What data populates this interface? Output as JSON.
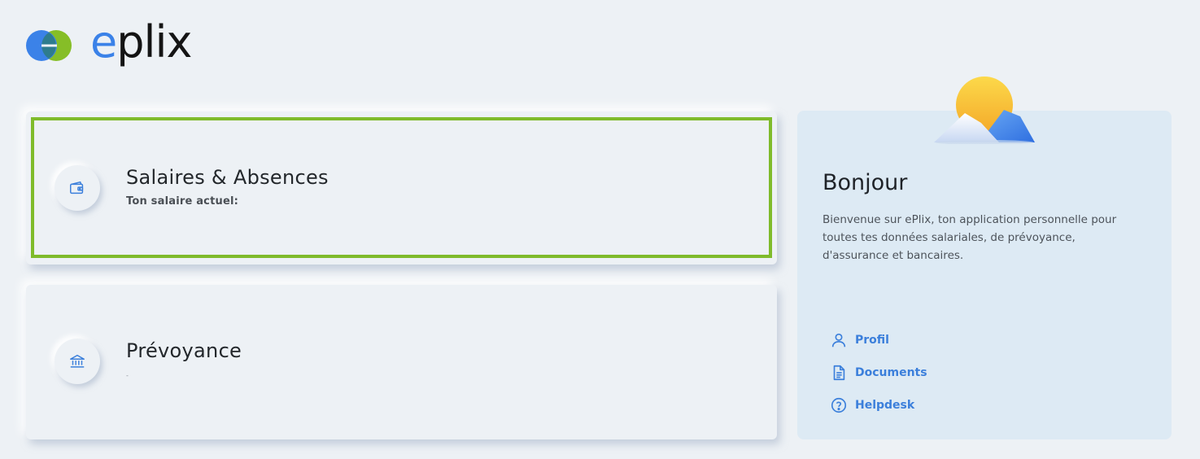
{
  "brand": {
    "name_first": "e",
    "name_rest": "plix",
    "logo_icon": "eplix-logo-icon",
    "colors": {
      "blue": "#3b82e8",
      "green": "#86be27",
      "text": "#141414"
    }
  },
  "cards": {
    "salary": {
      "title": "Salaires & Absences",
      "subtitle": "Ton salaire actuel:",
      "icon": "wallet-icon",
      "focus_color": "#7fbb2b"
    },
    "prevoyance": {
      "title": "Prévoyance",
      "subtitle": "-",
      "icon": "bank-icon"
    }
  },
  "welcome": {
    "title": "Bonjour",
    "text": "Bienvenue sur ePlix, ton application personnelle pour toutes tes données salariales, de prévoyance, d'assurance et bancaires.",
    "illustration": "sun-mountains-illustration",
    "links": [
      {
        "label": "Profil",
        "icon": "user-icon"
      },
      {
        "label": "Documents",
        "icon": "document-icon"
      },
      {
        "label": "Helpdesk",
        "icon": "help-circle-icon"
      }
    ],
    "link_color": "#3b7fdb"
  }
}
